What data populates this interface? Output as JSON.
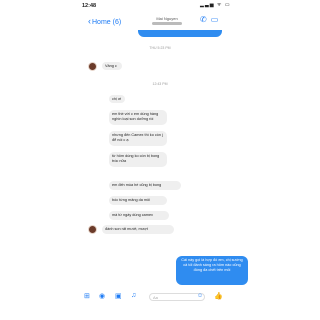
{
  "status": {
    "time": "12:48",
    "icons": "▂▃▅ ᯤ ▭"
  },
  "header": {
    "back_label": "Home (6)",
    "back_glyph": "‹",
    "contact_name": "Mai Nguyen",
    "call_glyph": "✆",
    "video_glyph": "▭"
  },
  "messages": {
    "ts1": "THU 5:23 PM",
    "vang": "Vâng c",
    "ts2": "12:43 PM",
    "m1": "chị ơi",
    "m2": "em thề với c em dùng hàng nghìn loại son dưỡng rồi",
    "m3": "nhưng đến Camex thì ko còn j để nói c ạ",
    "m4": "từ hôm dùng ko còn bị bong tróc nữa",
    "m5": "em đến mùa hè cũng bị bong",
    "m6": "bóc từng mảng da môi",
    "m7": "mà từ ngày dùng camex",
    "m8": "đánh son rất mướt, mượt",
    "me": "Cái này gọi là hợp đó em, chị sướng cả tối đánh sáng ra hôm nào cũng đóng đa chết trên môi"
  },
  "composer": {
    "icons": [
      "⊞",
      "◉",
      "▣",
      "♫"
    ],
    "placeholder": "Aa",
    "emoji": "☺",
    "like": "👍"
  }
}
